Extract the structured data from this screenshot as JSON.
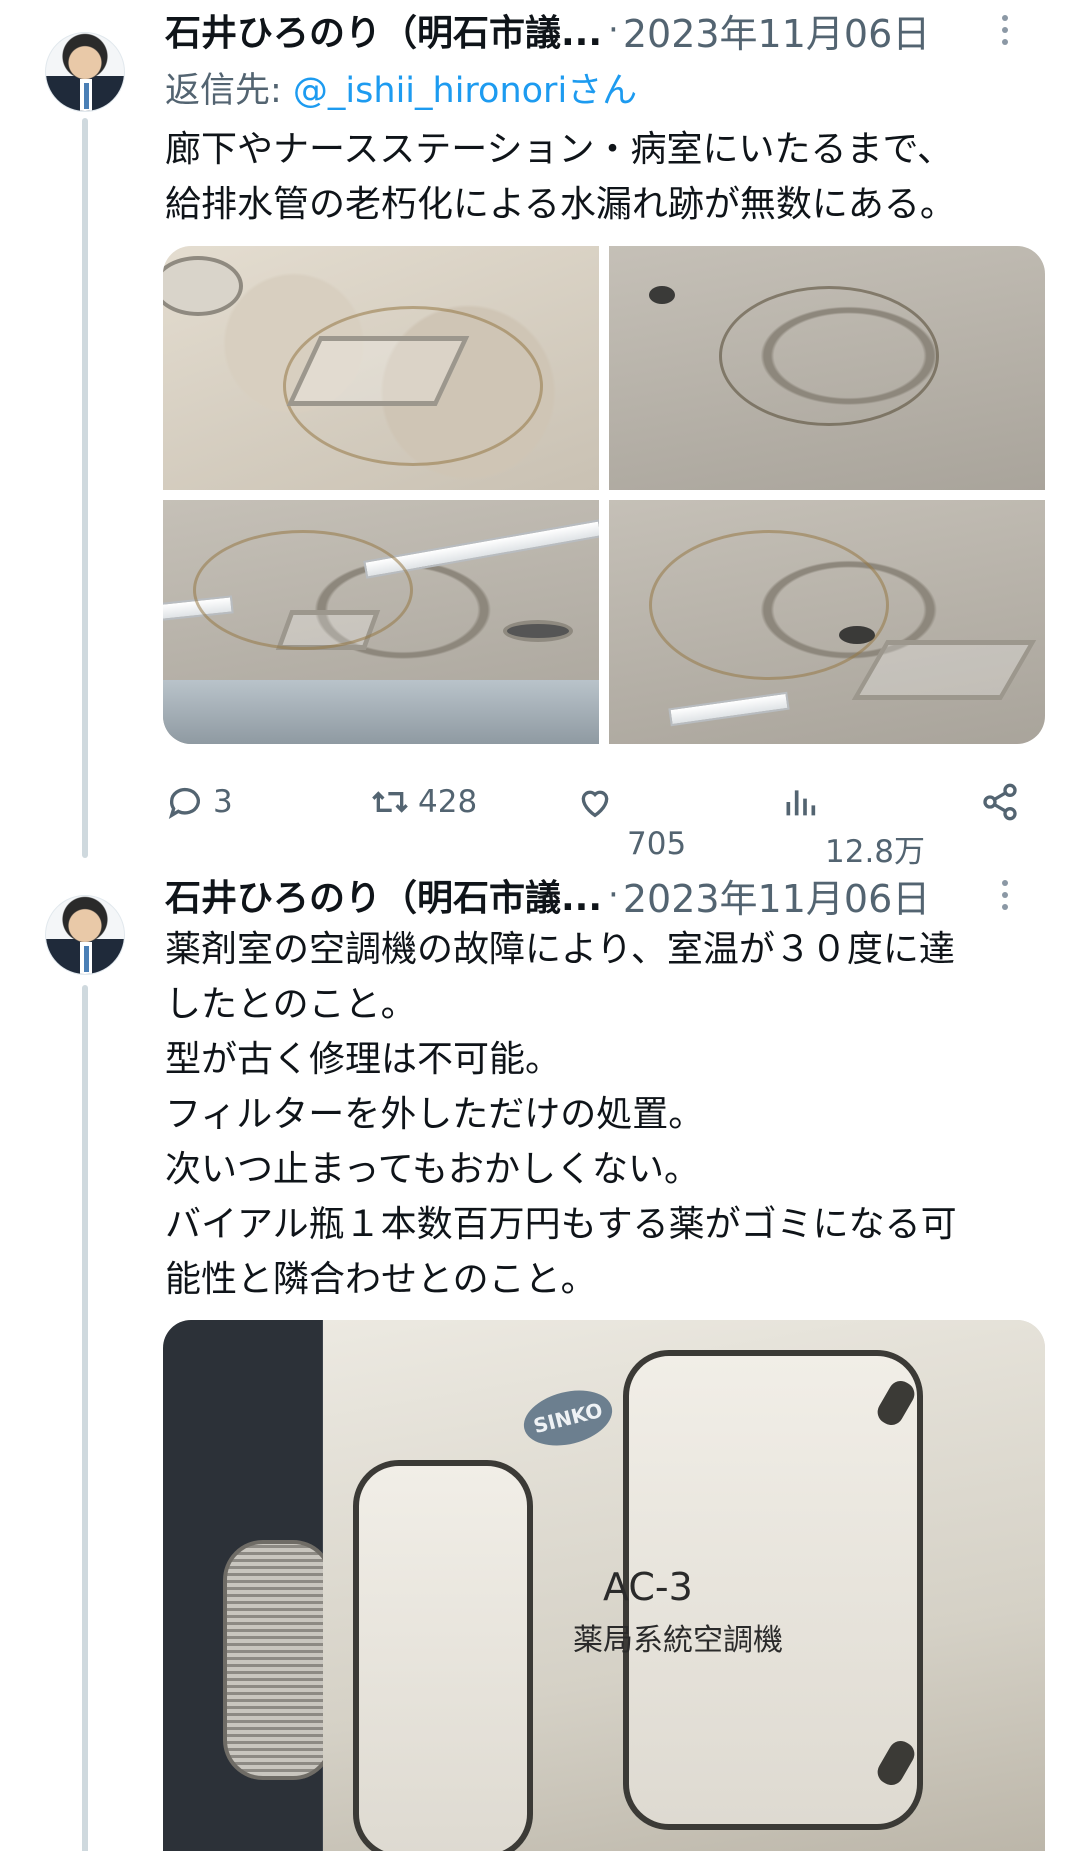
{
  "tweets": [
    {
      "author": "石井ひろのり（明石市議...",
      "separator": "·",
      "date": "2023年11月06日",
      "reply_to_prefix": "返信先: ",
      "reply_to_handle": "@_ishii_hironoriさん",
      "text_lines": [
        "廊下やナースステーション・病室にいたるまで、",
        "給排水管の老朽化による水漏れ跡が無数にある。"
      ],
      "stats": {
        "replies": "3",
        "retweets": "428",
        "likes": "705",
        "views": "12.8万"
      }
    },
    {
      "author": "石井ひろのり（明石市議...",
      "separator": "·",
      "date": "2023年11月06日",
      "text_lines": [
        "薬剤室の空調機の故障により、室温が３０度に達",
        "したとのこと。",
        "型が古く修理は不可能。",
        "フィルターを外しただけの処置。",
        "次いつ止まってもおかしくない。",
        "バイアル瓶１本数百万円もする薬がゴミになる可",
        "能性と隣合わせとのこと。"
      ],
      "image_text": {
        "brand": "SINKO",
        "unit": "AC-3",
        "unit_name": "薬局系統空調機"
      }
    }
  ],
  "icons": [
    "more-vertical-icon",
    "reply-icon",
    "retweet-icon",
    "like-icon",
    "views-icon",
    "share-icon"
  ],
  "colors": {
    "link": "#1d9bf0",
    "secondary_text": "#536471",
    "thread_line": "#cfd9de"
  }
}
